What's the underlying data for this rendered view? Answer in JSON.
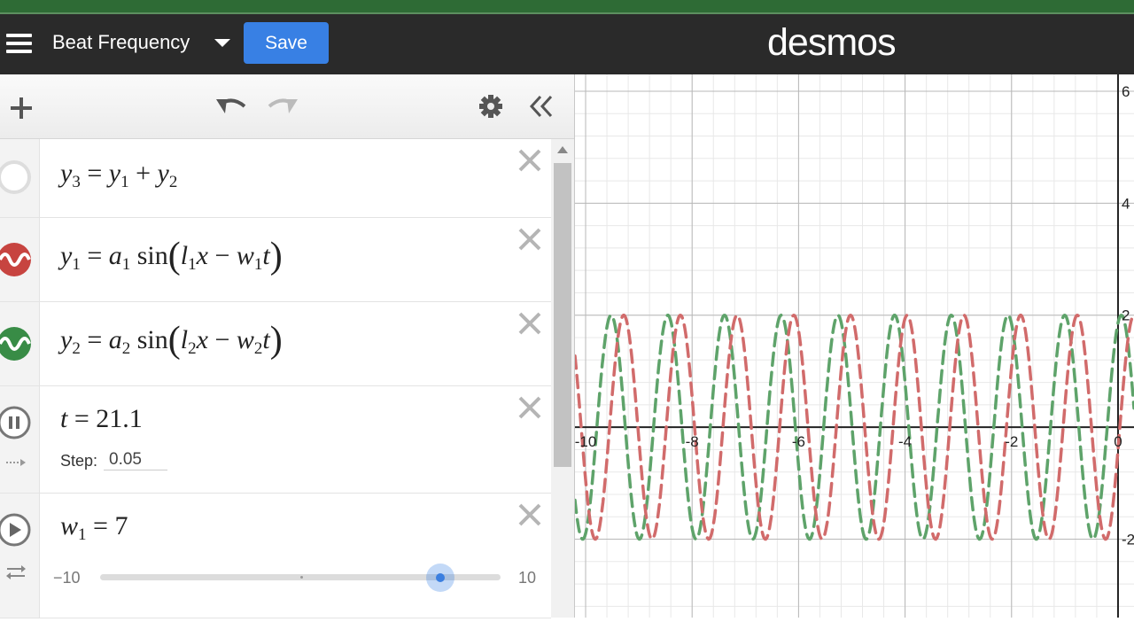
{
  "header": {
    "graph_title": "Beat Frequency",
    "save_label": "Save",
    "brand": "desmos"
  },
  "expressions": [
    {
      "id": "y3",
      "lhs": "y",
      "lhs_sub": "3",
      "rhs_a": "y",
      "rhs_a_sub": "1",
      "op": "+",
      "rhs_b": "y",
      "rhs_b_sub": "2",
      "icon": "hidden-circle-icon"
    },
    {
      "id": "y1",
      "lhs": "y",
      "lhs_sub": "1",
      "amp": "a",
      "amp_sub": "1",
      "func": "sin",
      "k": "l",
      "k_sub": "1",
      "var": "x",
      "minus": "−",
      "w": "w",
      "w_sub": "1",
      "t": "t",
      "color": "#c74440",
      "icon": "red-wave-icon"
    },
    {
      "id": "y2",
      "lhs": "y",
      "lhs_sub": "2",
      "amp": "a",
      "amp_sub": "2",
      "func": "sin",
      "k": "l",
      "k_sub": "2",
      "var": "x",
      "minus": "−",
      "w": "w",
      "w_sub": "2",
      "t": "t",
      "color": "#388c46",
      "icon": "green-wave-icon"
    },
    {
      "id": "t",
      "name": "t",
      "value": "21.1",
      "step_label": "Step:",
      "step_value": "0.05",
      "icon": "pause-icon"
    },
    {
      "id": "w1",
      "name": "w",
      "name_sub": "1",
      "value": "7",
      "min": "−10",
      "max": "10",
      "slider_fraction": 0.85,
      "icon": "play-icon"
    }
  ],
  "graph": {
    "x_ticks": [
      "-10",
      "-8",
      "-6",
      "-4",
      "-2",
      "0"
    ],
    "y_ticks": [
      "6",
      "4",
      "2",
      "-2"
    ],
    "x_range": [
      -10.2,
      0.3
    ],
    "y_range": [
      -3.4,
      6.3
    ],
    "amplitude": 2,
    "red_color": "#d16b6b",
    "green_color": "#5ea36a"
  }
}
